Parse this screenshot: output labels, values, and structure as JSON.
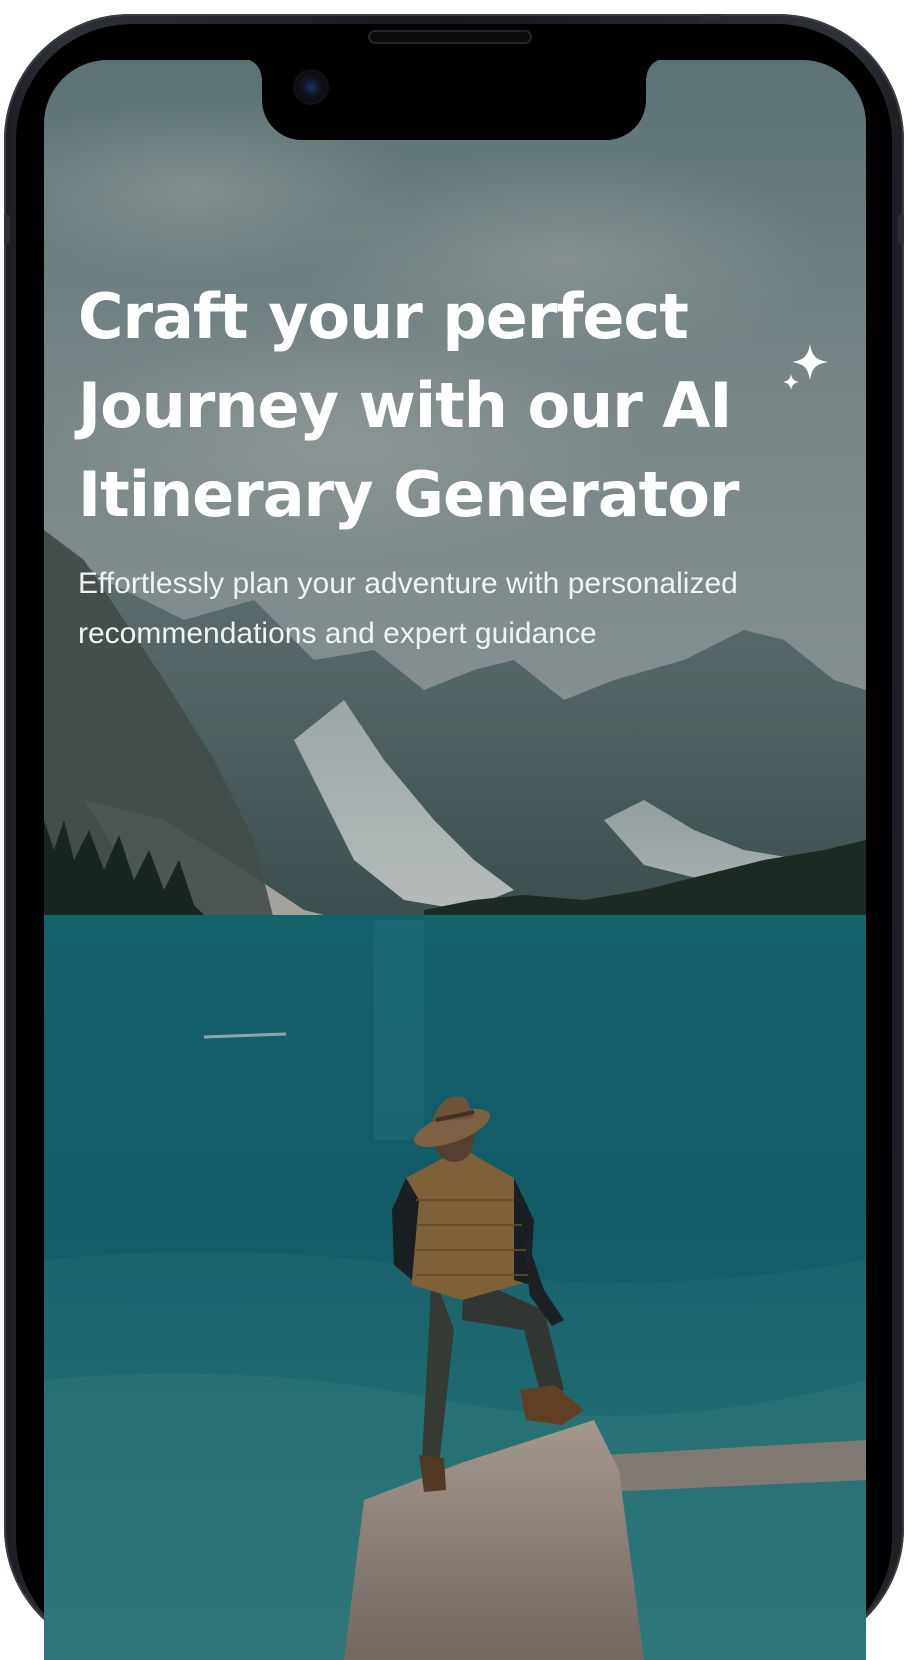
{
  "hero": {
    "headline": "Craft your perfect Journey with our AI Itinerary Generator",
    "subtitle": "Effortlessly plan your adventure with personalized recommendations and expert guidance"
  },
  "icons": {
    "sparkle": "sparkle-icon"
  },
  "colors": {
    "text": "#ffffff",
    "lake": "#1f6f7c",
    "sky": "#8a9fa3",
    "frame": "#1b1d22"
  }
}
